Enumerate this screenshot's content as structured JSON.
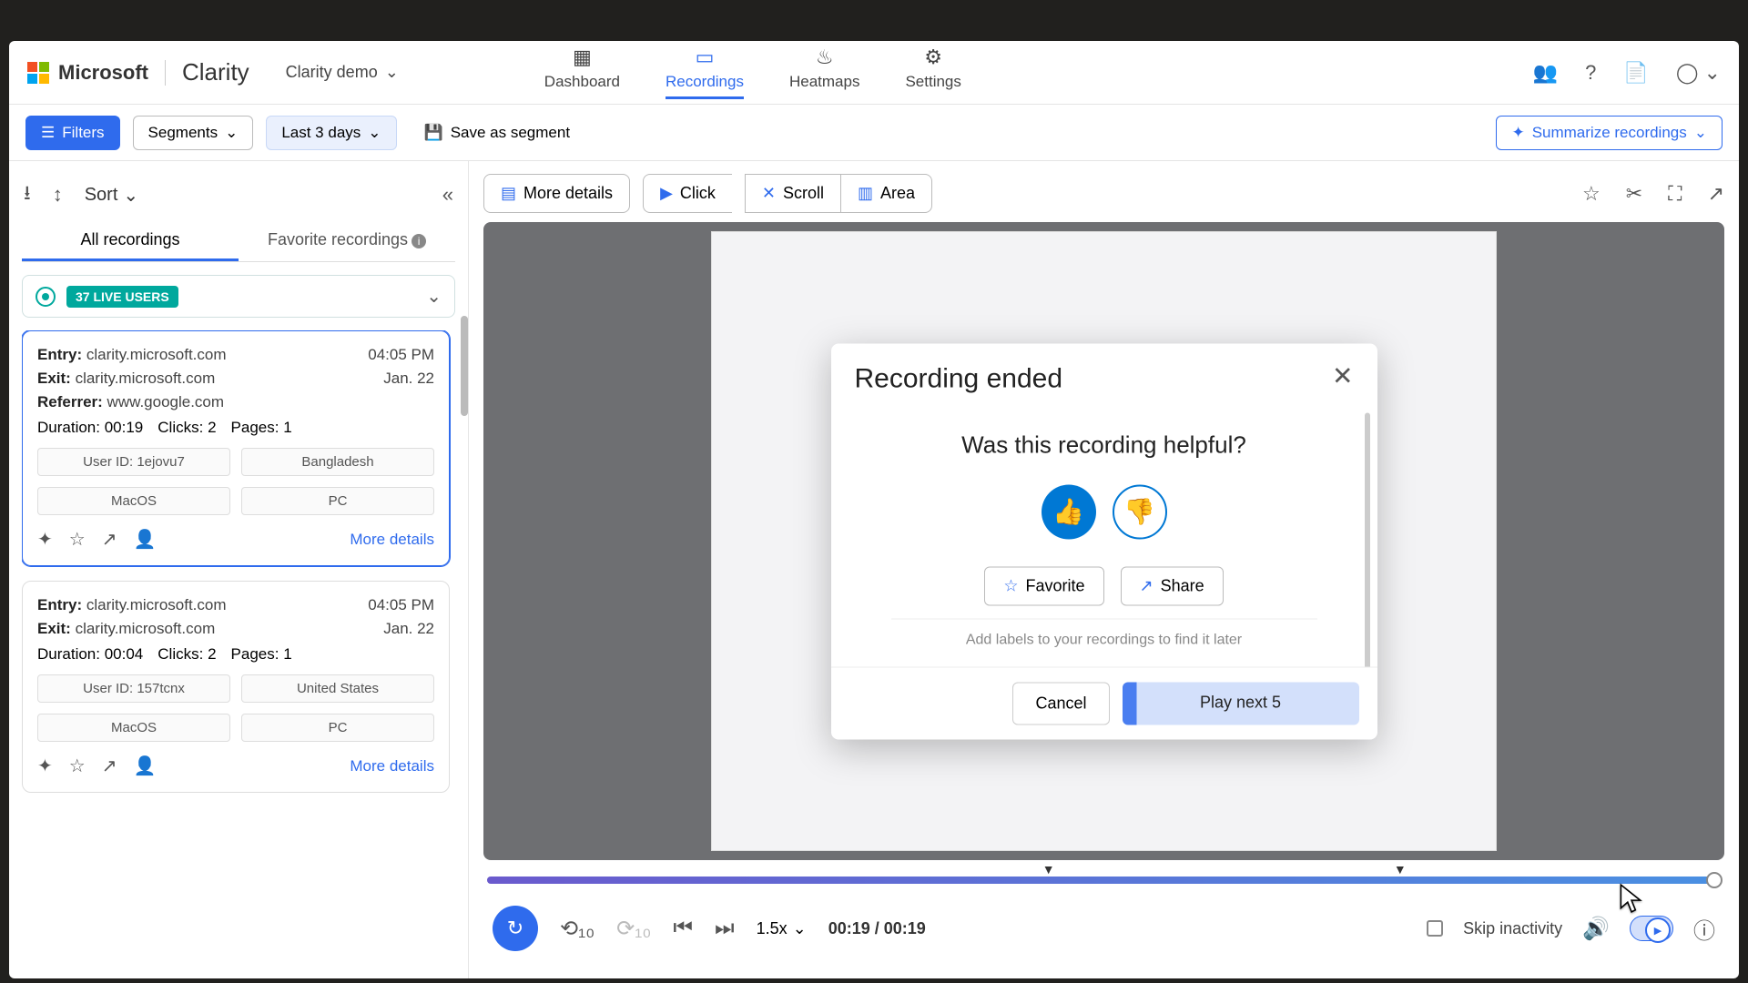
{
  "brand": {
    "ms": "Microsoft",
    "app": "Clarity",
    "demo": "Clarity demo"
  },
  "nav": {
    "dashboard": "Dashboard",
    "recordings": "Recordings",
    "heatmaps": "Heatmaps",
    "settings": "Settings"
  },
  "filters": {
    "filters": "Filters",
    "segments": "Segments",
    "range": "Last 3 days",
    "save": "Save as segment",
    "summarize": "Summarize recordings"
  },
  "side": {
    "sort": "Sort",
    "tab_all": "All recordings",
    "tab_fav": "Favorite recordings",
    "live": "37 LIVE USERS"
  },
  "cards": [
    {
      "entry_l": "Entry:",
      "entry": "clarity.microsoft.com",
      "exit_l": "Exit:",
      "exit": "clarity.microsoft.com",
      "ref_l": "Referrer:",
      "ref": "www.google.com",
      "dur_l": "Duration:",
      "dur": "00:19",
      "clk_l": "Clicks:",
      "clk": "2",
      "pg_l": "Pages:",
      "pg": "1",
      "time": "04:05 PM",
      "date": "Jan. 22",
      "chip1": "User ID: 1ejovu7",
      "chip2": "Bangladesh",
      "chip3": "MacOS",
      "chip4": "PC",
      "more": "More details"
    },
    {
      "entry_l": "Entry:",
      "entry": "clarity.microsoft.com",
      "exit_l": "Exit:",
      "exit": "clarity.microsoft.com",
      "dur_l": "Duration:",
      "dur": "00:04",
      "clk_l": "Clicks:",
      "clk": "2",
      "pg_l": "Pages:",
      "pg": "1",
      "time": "04:05 PM",
      "date": "Jan. 22",
      "chip1": "User ID: 157tcnx",
      "chip2": "United States",
      "chip3": "MacOS",
      "chip4": "PC",
      "more": "More details"
    }
  ],
  "toolbar": {
    "details": "More details",
    "click": "Click",
    "scroll": "Scroll",
    "area": "Area"
  },
  "modal": {
    "title": "Recording ended",
    "question": "Was this recording helpful?",
    "favorite": "Favorite",
    "share": "Share",
    "hint": "Add labels to your recordings to find it later",
    "cancel": "Cancel",
    "play": "Play next 5"
  },
  "player": {
    "speed": "1.5x",
    "time": "00:19 / 00:19",
    "skip": "Skip inactivity"
  }
}
